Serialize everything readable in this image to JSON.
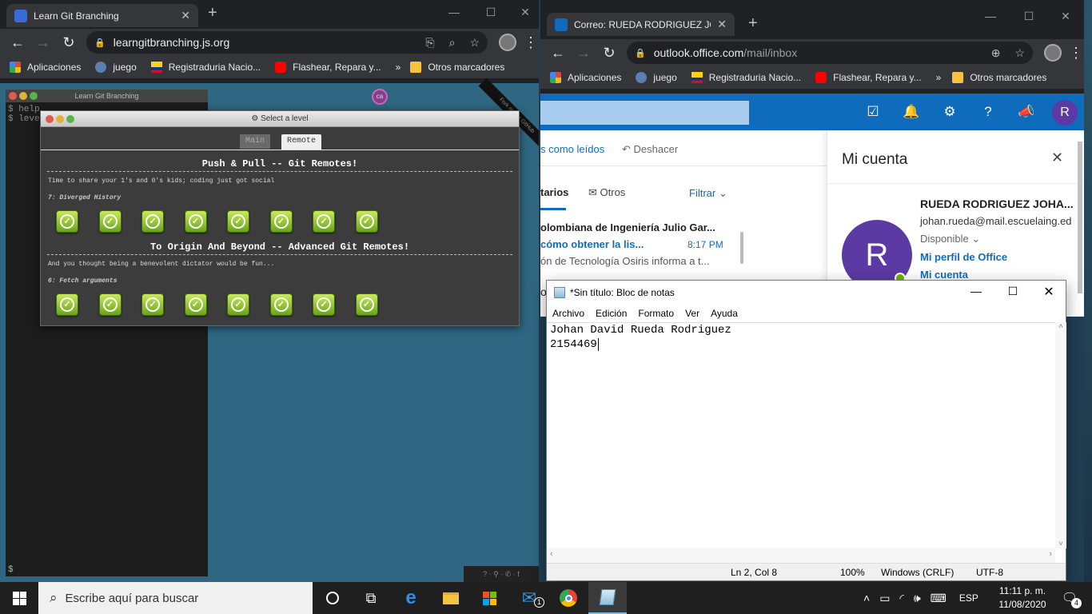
{
  "desktop": {
    "bg": "#1a3a4f"
  },
  "chrome_left": {
    "tab_title": "Learn Git Branching",
    "url": "learngitbranching.js.org",
    "bookmarks": [
      "Aplicaciones",
      "juego",
      "Registraduria Nacio...",
      "Flashear, Repara y...",
      "Otros marcadores"
    ],
    "overflow": "»"
  },
  "git_app": {
    "terminal_title": "Learn Git Branching",
    "terminal_lines": [
      "$ help",
      "$ level"
    ],
    "terminal_prompt": "$",
    "node_label": "ca",
    "ribbon": "Fork me on GitHub",
    "dialog_title": "Select a level",
    "tabs": [
      "Main",
      "Remote"
    ],
    "active_tab": "Remote",
    "sections": [
      {
        "title": "Push & Pull -- Git Remotes!",
        "description": "Time to share your 1's and 0's kids; coding just got social",
        "current": "7: Diverged History",
        "levels_completed": 8
      },
      {
        "title": "To Origin And Beyond -- Advanced Git Remotes!",
        "description": "And you thought being a benevolent dictator would be fun...",
        "current": "6: Fetch arguments",
        "levels_completed": 8
      }
    ]
  },
  "chrome_right": {
    "tab_title": "Correo: RUEDA RODRIGUEZ JOHA",
    "url_host": "outlook.office.com",
    "url_path": "/mail/inbox",
    "bookmarks": [
      "Aplicaciones",
      "juego",
      "Registraduria Nacio...",
      "Flashear, Repara y...",
      "Otros marcadores"
    ],
    "overflow": "»"
  },
  "outlook": {
    "avatar_letter": "R",
    "cmd_mark_read": "s como leídos",
    "cmd_undo": "Deshacer",
    "tab_focused": "tarios",
    "tab_other": "Otros",
    "filter": "Filtrar",
    "message": {
      "sender": "olombiana de Ingeniería Julio Gar...",
      "subject": "cómo obtener la lis...",
      "time": "8:17 PM",
      "preview": "ón de Tecnología Osiris informa a t..."
    },
    "partial_text": "o",
    "account_panel": {
      "title": "Mi cuenta",
      "name": "RUEDA RODRIGUEZ JOHA...",
      "email": "johan.rueda@mail.escuelaing.ed",
      "status": "Disponible",
      "link_profile": "Mi perfil de Office",
      "link_account": "Mi cuenta"
    }
  },
  "notepad": {
    "title": "*Sin título: Bloc de notas",
    "menu": [
      "Archivo",
      "Edición",
      "Formato",
      "Ver",
      "Ayuda"
    ],
    "lines": [
      "Johan David Rueda Rodriguez",
      "2154469"
    ],
    "status": {
      "position": "Ln 2, Col 8",
      "zoom": "100%",
      "eol": "Windows (CRLF)",
      "encoding": "UTF-8"
    }
  },
  "taskbar": {
    "search_placeholder": "Escribe aquí para buscar",
    "mail_badge": "1",
    "lang": "ESP",
    "time": "11:11 p. m.",
    "date": "11/08/2020",
    "notif_count": "4"
  }
}
